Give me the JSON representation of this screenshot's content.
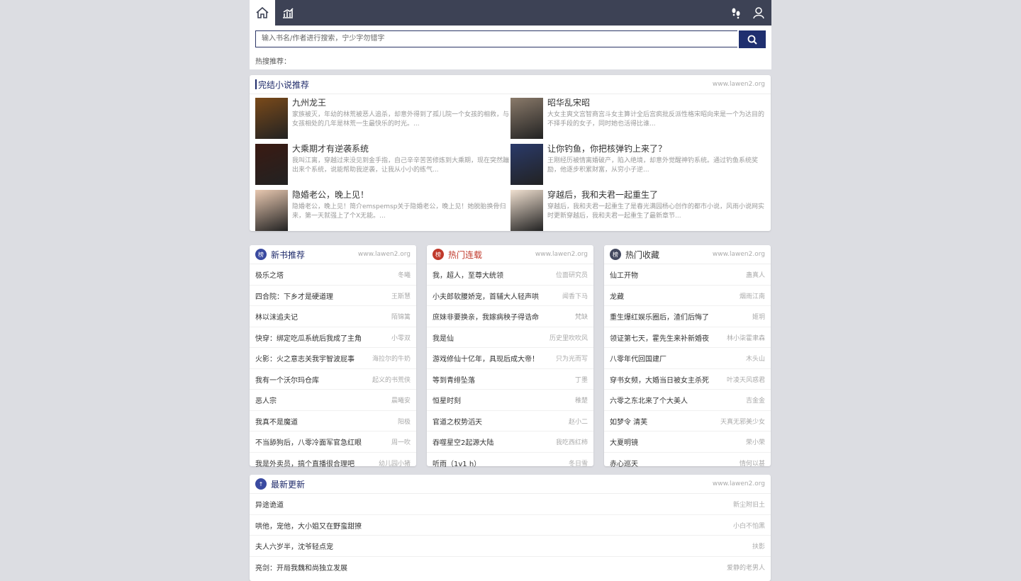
{
  "search": {
    "placeholder": "输入书名/作者进行搜索，宁少字勿错字",
    "hot_label": "热搜推荐："
  },
  "site": "www.lawen2.org",
  "featured": {
    "title": "完结小说推荐",
    "books": [
      {
        "title": "九州龙王",
        "desc": "家族被灭，年幼的林荒被恶人追杀，却意外得到了孤儿院一个女孩的相救，与女孩相处的几年是林荒一生最快乐的时光。..."
      },
      {
        "title": "昭华乱宋昭",
        "desc": "大女主爽文宫智商宫斗女主算计全后宫疯批反派性格宋昭向来是一个为达目的不择手段的女子，同时她也活得比谁..."
      },
      {
        "title": "大乘期才有逆袭系统",
        "desc": "我叫江离，穿越过来没见到金手指，自己辛辛苦苦修炼到大乘期，现在突然蹦出来个系统，说能帮助我逆袭，让我从小小的练气..."
      },
      {
        "title": "让你钓鱼，你把核弹钓上来了？",
        "desc": "王刚经历被情离婚破产，陷入绝境，却意外觉醒神钓系统。通过钓鱼系统奖励，他逐步积累财富，从穷小子逆..."
      },
      {
        "title": "隐婚老公，晚上见！",
        "desc": "隐婚老公，晚上见！简介emspemsp关于隐婚老公，晚上见！她脱胎换骨归来，第一天就强上了个X无能。..."
      },
      {
        "title": "穿越后，我和夫君一起重生了",
        "desc": "穿越后，我和夫君一起重生了是春光满园杨心创作的都市小说，风雨小说网实时更新穿越后，我和夫君一起重生了最新章节..."
      }
    ]
  },
  "columns": [
    {
      "title": "新书推荐",
      "badge": "榜",
      "rows": [
        [
          "极乐之塔",
          "冬曦"
        ],
        [
          "四合院：下乡才是硬道理",
          "王斯慧"
        ],
        [
          "林以沫追夫记",
          "陌锦篱"
        ],
        [
          "快穿：绑定吃瓜系统后我成了主角",
          "小零双"
        ],
        [
          "火影：火之意志关我宇智波屁事",
          "海拉尔的牛奶"
        ],
        [
          "我有一个沃尔玛仓库",
          "起义的书荒侠"
        ],
        [
          "恶人宗",
          "晨曦安"
        ],
        [
          "我真不是魔道",
          "阳极"
        ],
        [
          "不当舔狗后，八零冷面军官急红眼",
          "周一吹"
        ],
        [
          "我是外卖员，搞个直播很合理吧",
          "幼儿园小猪"
        ]
      ]
    },
    {
      "title": "热门连载",
      "badge": "榜",
      "rows": [
        [
          "我，超人，至尊大统领",
          "位面研究员"
        ],
        [
          "小夫郎软腰娇宠，首辅大人轻声哄",
          "闻香下马"
        ],
        [
          "庶妹非要换亲，我嫁病秧子得诰命",
          "梵缺"
        ],
        [
          "我是仙",
          "历史里吹吹风"
        ],
        [
          "游戏修仙十亿年，具现后成大帝！",
          "只为光而写"
        ],
        [
          "等到青绯坠落",
          "丁墨"
        ],
        [
          "恒星时刻",
          "稚楚"
        ],
        [
          "官道之权势滔天",
          "赵小二"
        ],
        [
          "吞噬星空2起源大陆",
          "我吃西红柿"
        ],
        [
          "听雨（1v1 h）",
          "冬日雪"
        ]
      ]
    },
    {
      "title": "热门收藏",
      "badge": "榜",
      "rows": [
        [
          "仙工开物",
          "蛊真人"
        ],
        [
          "龙藏",
          "烟雨江南"
        ],
        [
          "重生爆红娱乐圈后，渣们后悔了",
          "姬玥"
        ],
        [
          "领证第七天，霍先生来补新婚夜",
          "林小柒霍聿森"
        ],
        [
          "八零年代回国建厂",
          "木头山"
        ],
        [
          "穿书女频，大婚当日被女主杀死",
          "叶凌天风惑君"
        ],
        [
          "六零之东北来了个大美人",
          "吉金金"
        ],
        [
          "如梦令 清芙",
          "天真无邪美少女"
        ],
        [
          "大夏明镜",
          "荣小荣"
        ],
        [
          "赤心巡天",
          "情何以甚"
        ]
      ]
    }
  ],
  "latest": {
    "title": "最新更新",
    "rows": [
      [
        "异途诡道",
        "新尘附旧土"
      ],
      [
        "哄他，宠他，大小姐又在野蛮甜撩",
        "小白不怕黑"
      ],
      [
        "夫人六岁半，沈爷轻点宠",
        "扶影"
      ],
      [
        "亮剑：开局我魏和尚独立发展",
        "爱静的老男人"
      ]
    ]
  },
  "colors": {
    "topbar": "#3d4255",
    "accent": "#1e2a6a",
    "hot": "#c0392b"
  }
}
